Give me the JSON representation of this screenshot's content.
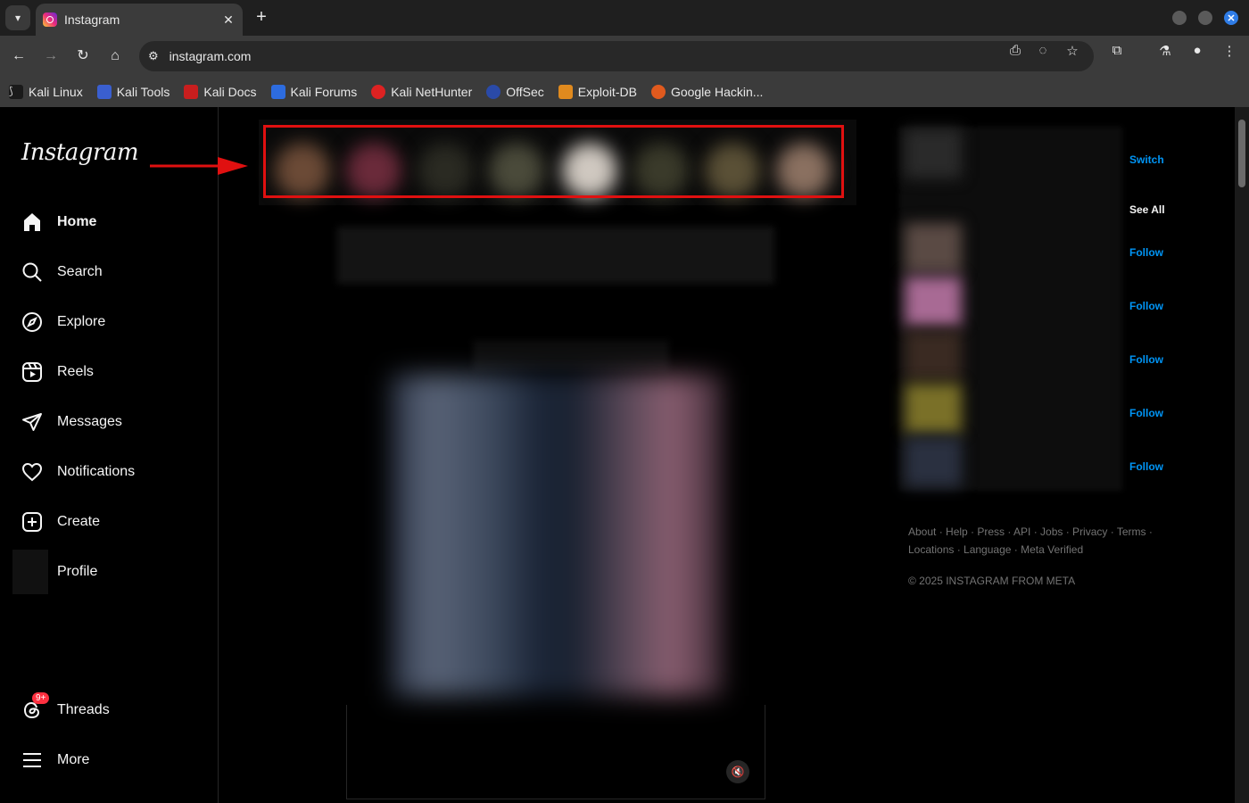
{
  "browser": {
    "tab_title": "Instagram",
    "url": "instagram.com",
    "bookmarks": [
      "Kali Linux",
      "Kali Tools",
      "Kali Docs",
      "Kali Forums",
      "Kali NetHunter",
      "OffSec",
      "Exploit-DB",
      "Google Hackin..."
    ]
  },
  "sidebar": {
    "logo": "Instagram",
    "items": [
      {
        "label": "Home",
        "icon": "home-icon"
      },
      {
        "label": "Search",
        "icon": "search-icon"
      },
      {
        "label": "Explore",
        "icon": "compass-icon"
      },
      {
        "label": "Reels",
        "icon": "reels-icon"
      },
      {
        "label": "Messages",
        "icon": "send-icon"
      },
      {
        "label": "Notifications",
        "icon": "heart-icon"
      },
      {
        "label": "Create",
        "icon": "plus-square-icon"
      },
      {
        "label": "Profile",
        "icon": "avatar"
      }
    ],
    "threads": {
      "label": "Threads",
      "badge": "9+"
    },
    "more": {
      "label": "More"
    }
  },
  "suggestions": {
    "switch": "Switch",
    "see_all": "See All",
    "follow": "Follow"
  },
  "footer": {
    "links": "About · Help · Press · API · Jobs · Privacy · Terms · Locations · Language · Meta Verified",
    "copyright": "© 2025 INSTAGRAM FROM META"
  },
  "colors": {
    "accent": "#0095f6",
    "highlight": "#e01010",
    "badge": "#ff3040"
  }
}
